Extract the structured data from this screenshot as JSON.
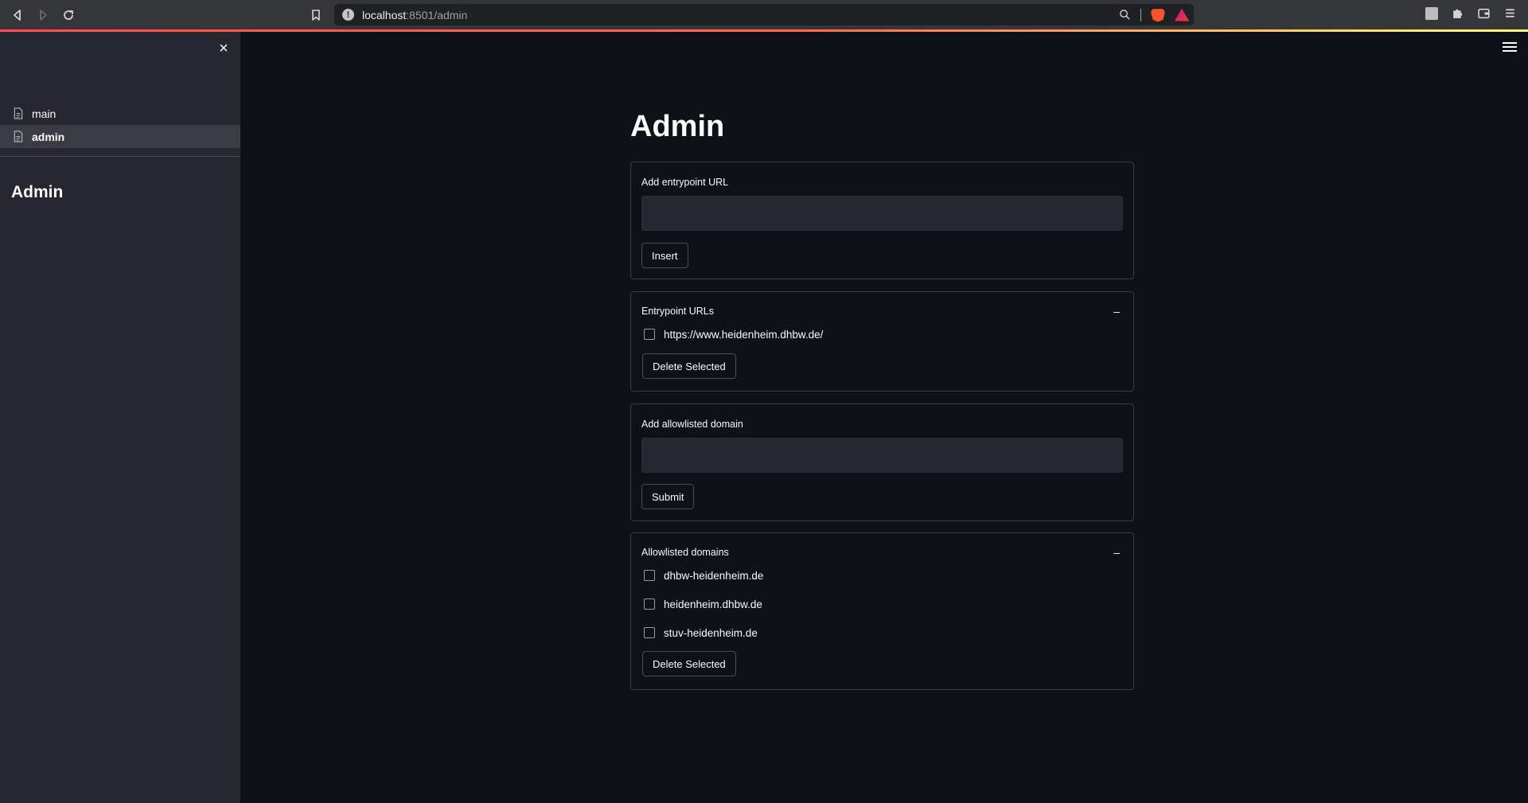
{
  "browser": {
    "url_host": "localhost",
    "url_path": ":8501/admin",
    "shields_count": "1",
    "rewards_count": "1"
  },
  "sidebar": {
    "close_icon": "×",
    "items": [
      {
        "label": "main",
        "active": false
      },
      {
        "label": "admin",
        "active": true
      }
    ],
    "title": "Admin"
  },
  "main": {
    "title": "Admin",
    "entrypoint_form": {
      "label": "Add entrypoint URL",
      "value": "",
      "button": "Insert"
    },
    "entrypoint_list": {
      "title": "Entrypoint URLs",
      "collapse_icon": "–",
      "items": [
        "https://www.heidenheim.dhbw.de/"
      ],
      "delete_button": "Delete Selected"
    },
    "domain_form": {
      "label": "Add allowlisted domain",
      "value": "",
      "button": "Submit"
    },
    "domain_list": {
      "title": "Allowlisted domains",
      "collapse_icon": "–",
      "items": [
        "dhbw-heidenheim.de",
        "heidenheim.dhbw.de",
        "stuv-heidenheim.de"
      ],
      "delete_button": "Delete Selected"
    }
  },
  "colors": {
    "background": "#0e1117",
    "sidebar": "#262730",
    "accent": "#ff4b4b"
  }
}
